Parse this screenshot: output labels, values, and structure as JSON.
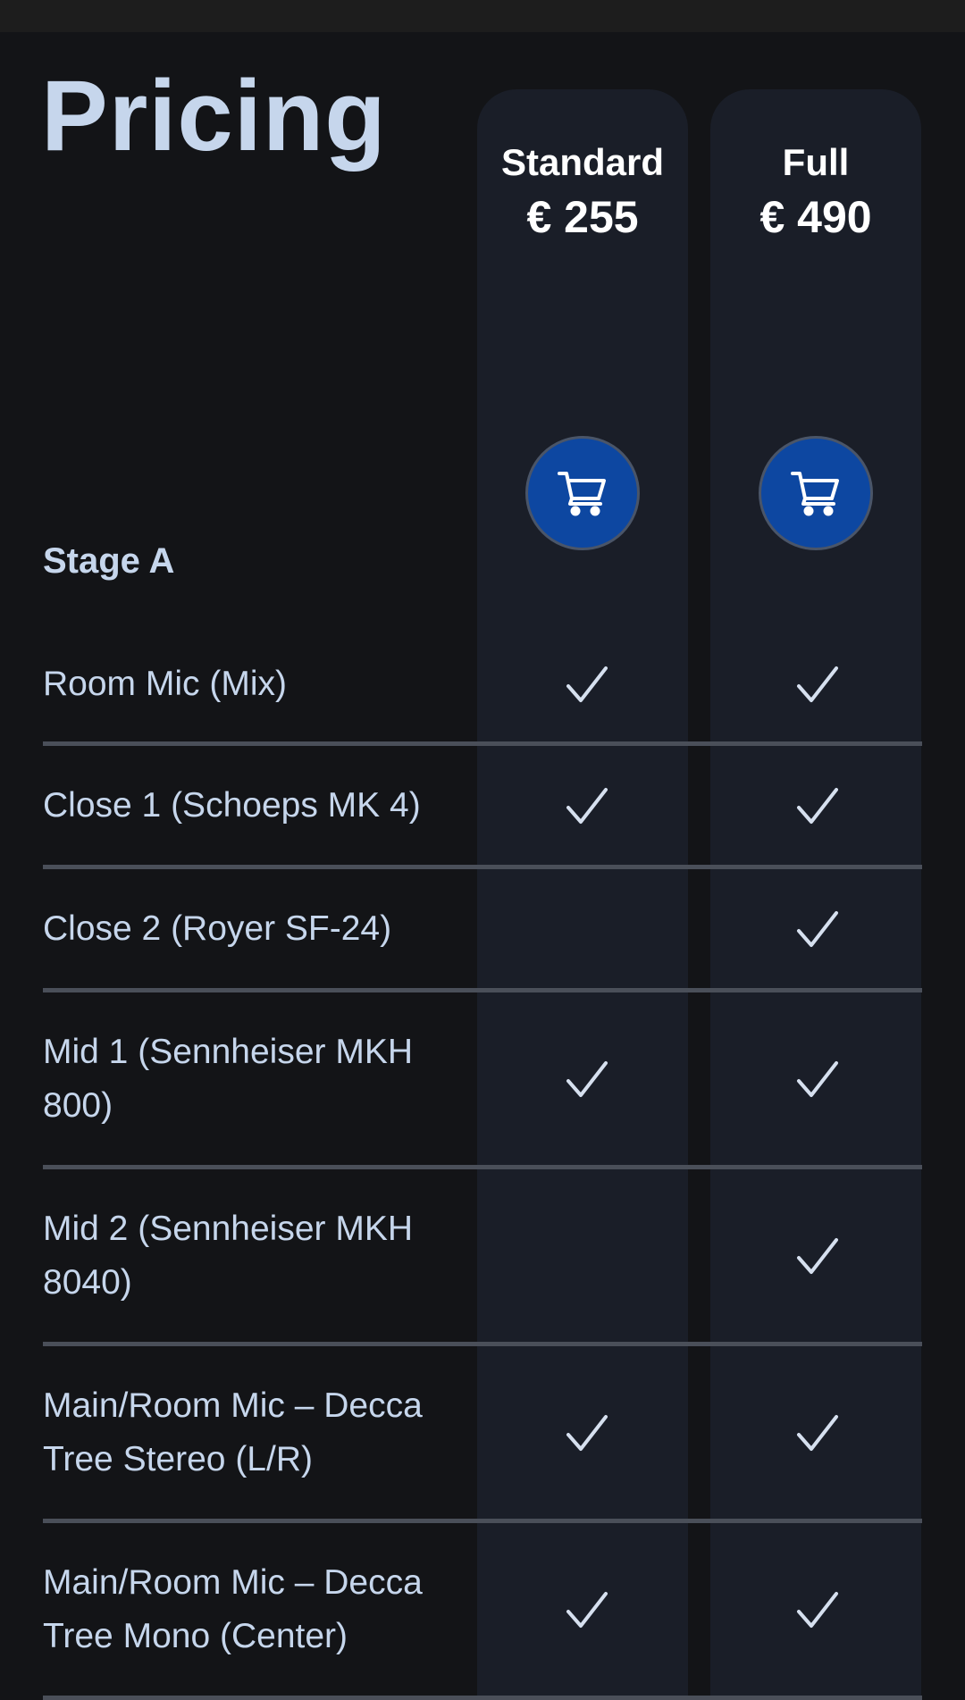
{
  "page": {
    "title": "Pricing",
    "section_label": "Stage A"
  },
  "plans": [
    {
      "name": "Standard",
      "price": "€ 255",
      "cart_icon": "cart-icon"
    },
    {
      "name": "Full",
      "price": "€ 490",
      "cart_icon": "cart-icon"
    }
  ],
  "features": [
    {
      "label": "Room Mic (Mix)",
      "standard": true,
      "full": true
    },
    {
      "label": "Close 1 (Schoeps MK 4)",
      "standard": true,
      "full": true
    },
    {
      "label": "Close 2 (Royer SF-24)",
      "standard": false,
      "full": true
    },
    {
      "label": "Mid 1 (Sennheiser MKH 800)",
      "standard": true,
      "full": true
    },
    {
      "label": "Mid 2 (Sennheiser MKH 8040)",
      "standard": false,
      "full": true
    },
    {
      "label": "Main/Room Mic – Decca Tree Stereo (L/R)",
      "standard": true,
      "full": true
    },
    {
      "label": "Main/Room Mic – Decca Tree Mono (Center)",
      "standard": true,
      "full": true
    }
  ],
  "colors": {
    "background": "#131417",
    "column": "#1a1e28",
    "cart_button": "#0d47a1",
    "text": "#c6d6ec",
    "divider": "#4a4f59"
  }
}
